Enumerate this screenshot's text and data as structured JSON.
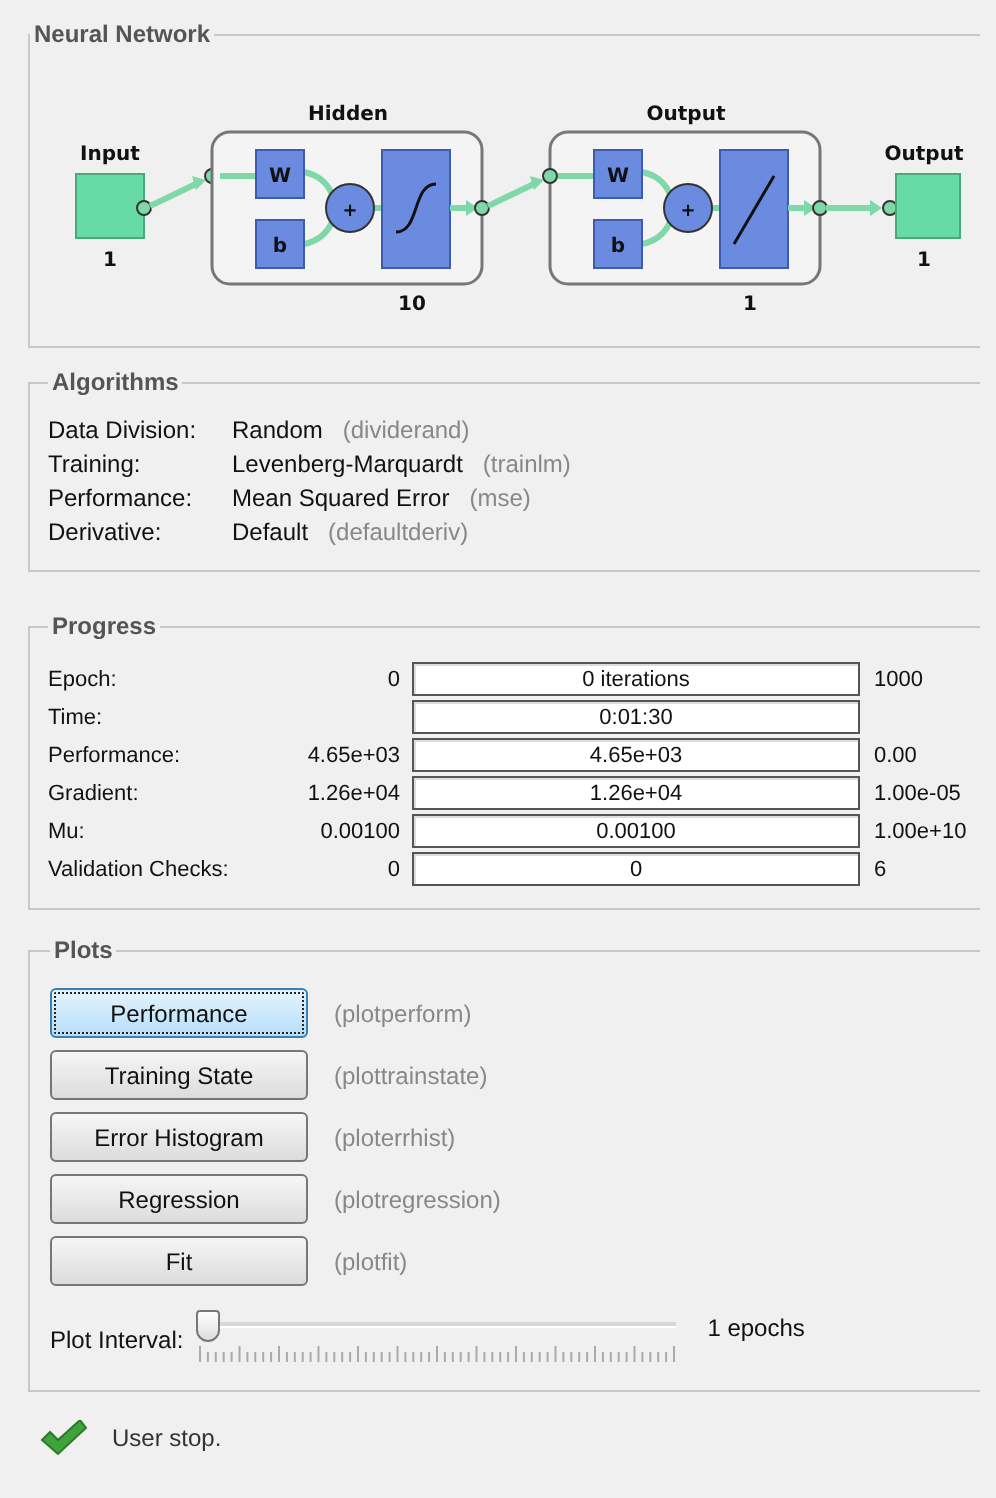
{
  "network": {
    "title": "Neural Network",
    "input": {
      "label": "Input",
      "size": "1"
    },
    "layers": [
      {
        "label": "Hidden",
        "size": "10",
        "weight": "W",
        "bias": "b",
        "sum": "+",
        "kind": "sigmoid"
      },
      {
        "label": "Output",
        "size": "1",
        "weight": "W",
        "bias": "b",
        "sum": "+",
        "kind": "linear"
      }
    ],
    "output": {
      "label": "Output",
      "size": "1"
    }
  },
  "algorithms": {
    "title": "Algorithms",
    "rows": [
      {
        "label": "Data Division:",
        "value": "Random",
        "function": "(dividerand)"
      },
      {
        "label": "Training:",
        "value": "Levenberg-Marquardt",
        "function": "(trainlm)"
      },
      {
        "label": "Performance:",
        "value": "Mean Squared Error",
        "function": "(mse)"
      },
      {
        "label": "Derivative:",
        "value": "Default",
        "function": "(defaultderiv)"
      }
    ]
  },
  "progress": {
    "title": "Progress",
    "rows": [
      {
        "label": "Epoch:",
        "start": "0",
        "current": "0 iterations",
        "end": "1000",
        "level": 0
      },
      {
        "label": "Time:",
        "current": "0:01:30",
        "level": 0
      },
      {
        "label": "Performance:",
        "start": "4.65e+03",
        "current": "4.65e+03",
        "end": "0.00",
        "level": 0
      },
      {
        "label": "Gradient:",
        "start": "1.26e+04",
        "current": "1.26e+04",
        "end": "1.00e-05",
        "level": 0
      },
      {
        "label": "Mu:",
        "start": "0.00100",
        "current": "0.00100",
        "end": "1.00e+10",
        "level": 0
      },
      {
        "label": "Validation Checks:",
        "start": "0",
        "current": "0",
        "end": "6",
        "level": 0
      }
    ]
  },
  "plots": {
    "title": "Plots",
    "buttons": [
      {
        "label": "Performance",
        "function": "(plotperform)",
        "selected": true
      },
      {
        "label": "Training State",
        "function": "(plottrainstate)",
        "selected": false
      },
      {
        "label": "Error Histogram",
        "function": "(ploterrhist)",
        "selected": false
      },
      {
        "label": "Regression",
        "function": "(plotregression)",
        "selected": false
      },
      {
        "label": "Fit",
        "function": "(plotfit)",
        "selected": false
      }
    ],
    "interval": {
      "label": "Plot Interval:",
      "level": 0,
      "reading": "1 epochs"
    }
  },
  "status": {
    "text": "User stop."
  }
}
